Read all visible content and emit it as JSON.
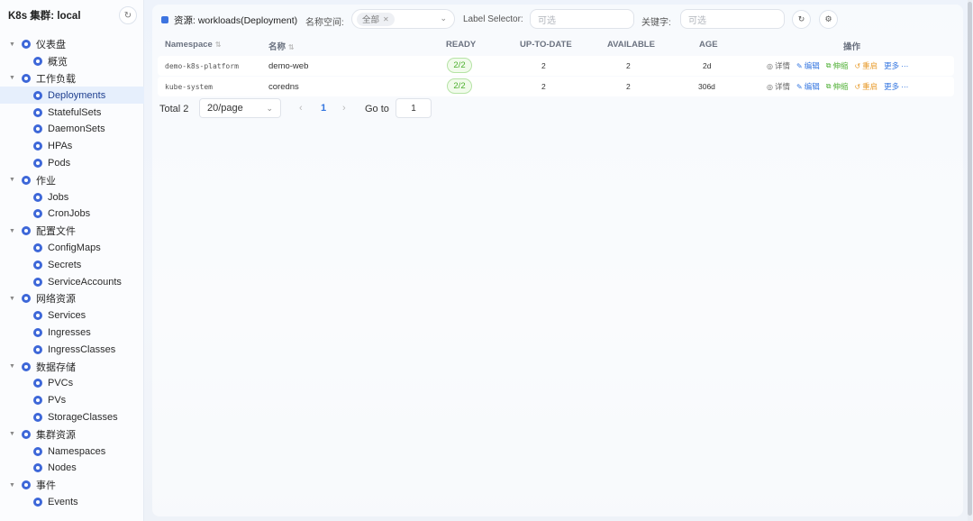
{
  "sidebar": {
    "title": "K8s 集群: local",
    "refresh_icon": "refresh-icon",
    "groups": [
      {
        "label": "仪表盘",
        "items": [
          {
            "label": "概览"
          }
        ]
      },
      {
        "label": "工作负载",
        "items": [
          {
            "label": "Deployments",
            "active": true
          },
          {
            "label": "StatefulSets"
          },
          {
            "label": "DaemonSets"
          },
          {
            "label": "HPAs"
          },
          {
            "label": "Pods"
          }
        ]
      },
      {
        "label": "作业",
        "items": [
          {
            "label": "Jobs"
          },
          {
            "label": "CronJobs"
          }
        ]
      },
      {
        "label": "配置文件",
        "items": [
          {
            "label": "ConfigMaps"
          },
          {
            "label": "Secrets"
          },
          {
            "label": "ServiceAccounts"
          }
        ]
      },
      {
        "label": "网络资源",
        "items": [
          {
            "label": "Services"
          },
          {
            "label": "Ingresses"
          },
          {
            "label": "IngressClasses"
          }
        ]
      },
      {
        "label": "数据存储",
        "items": [
          {
            "label": "PVCs"
          },
          {
            "label": "PVs"
          },
          {
            "label": "StorageClasses"
          }
        ]
      },
      {
        "label": "集群资源",
        "items": [
          {
            "label": "Namespaces"
          },
          {
            "label": "Nodes"
          }
        ]
      },
      {
        "label": "事件",
        "items": [
          {
            "label": "Events"
          }
        ]
      }
    ]
  },
  "toolbar": {
    "resource_label": "资源: workloads(Deployment)",
    "namespace_label": "名称空间:",
    "namespace_chip": "全部",
    "label_selector_label": "Label Selector:",
    "label_selector_placeholder": "可选",
    "keyword_label": "关键字:",
    "keyword_placeholder": "可选"
  },
  "table": {
    "headers": {
      "namespace": "Namespace",
      "name": "名称",
      "ready": "READY",
      "uptodate": "UP-TO-DATE",
      "available": "AVAILABLE",
      "age": "AGE",
      "ops": "操作"
    },
    "rows": [
      {
        "namespace": "demo-k8s-platform",
        "name": "demo-web",
        "ready": "2/2",
        "uptodate": "2",
        "available": "2",
        "age": "2d"
      },
      {
        "namespace": "kube-system",
        "name": "coredns",
        "ready": "2/2",
        "uptodate": "2",
        "available": "2",
        "age": "306d"
      }
    ],
    "actions": {
      "detail": "详情",
      "edit": "编辑",
      "scale": "伸缩",
      "restart": "重启",
      "more": "更多"
    },
    "colors": {
      "detail": "#666666",
      "edit": "#3476e0",
      "scale": "#52b038",
      "restart": "#e79a2a",
      "more": "#3476e0"
    }
  },
  "pagination": {
    "total": "Total 2",
    "page_size": "20/page",
    "current_page": "1",
    "goto_label": "Go to",
    "goto_value": "1"
  }
}
